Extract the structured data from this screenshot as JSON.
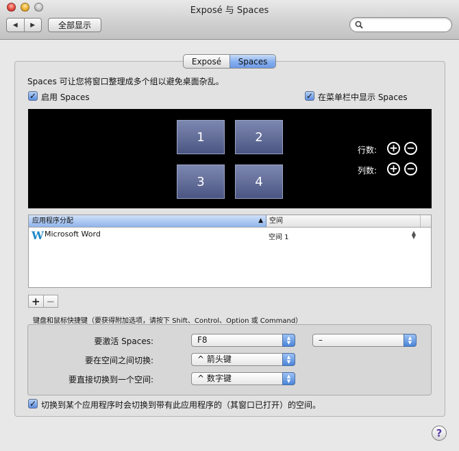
{
  "window": {
    "title": "Exposé 与 Spaces"
  },
  "toolbar": {
    "back_icon": "back-arrow-icon",
    "forward_icon": "forward-arrow-icon",
    "show_all_label": "全部显示",
    "search_placeholder": ""
  },
  "tabs": [
    {
      "label": "Exposé",
      "selected": false
    },
    {
      "label": "Spaces",
      "selected": true
    }
  ],
  "description": "Spaces 可让您将窗口整理成多个组以避免桌面杂乱。",
  "enable_spaces": {
    "label": "启用 Spaces",
    "checked": true
  },
  "show_in_menubar": {
    "label": "在菜单栏中显示 Spaces",
    "checked": true
  },
  "preview": {
    "spaces": [
      "1",
      "2",
      "3",
      "4"
    ],
    "rows_label": "行数:",
    "columns_label": "列数:",
    "add_symbol": "+",
    "remove_symbol": "−"
  },
  "bindings_table": {
    "col_app": "应用程序分配",
    "col_space": "空间",
    "sort_indicator": "▲",
    "rows": [
      {
        "app": "Microsoft Word",
        "icon": "W",
        "space": "空间 1"
      }
    ]
  },
  "add_remove": {
    "add": "+",
    "remove": "−"
  },
  "shortcuts": {
    "caption": "键盘和鼠标快捷键（要获得附加选项，请按下 Shift、Control、Option 或 Command）",
    "activate_label": "要激活 Spaces:",
    "activate_value": "F8",
    "activate_mouse_value": "–",
    "switch_label": "要在空间之间切换:",
    "switch_value": "^ 箭头键",
    "direct_label": "要直接切换到一个空间:",
    "direct_value": "^ 数字键"
  },
  "switch_on_app": {
    "label": "切换到某个应用程序时会切换到带有此应用程序的（其窗口已打开）的空间。",
    "checked": true
  },
  "help_symbol": "?"
}
